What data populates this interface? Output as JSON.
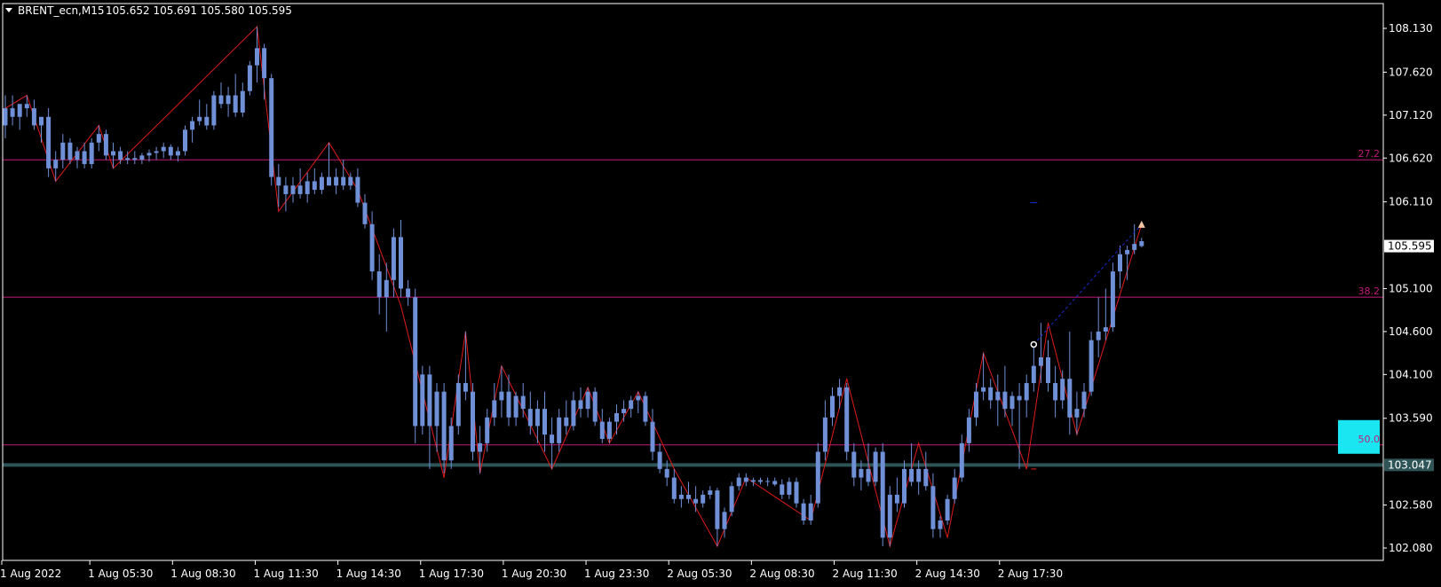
{
  "header": {
    "symbol": "BRENT_ecn,M15",
    "ohlc": "105.652 105.691 105.580 105.595"
  },
  "colors": {
    "background": "#000000",
    "frame": "#ffffff",
    "candle_body": "#6f8fd6",
    "candle_wick": "#6f8fd6",
    "zigzag": "#e01b1b",
    "fibo": "#c2197a",
    "support": "#2f5457",
    "cyan_box": "#19e6f0",
    "projection": "#1b2bd6",
    "arrow_marker": "#f3c6a0"
  },
  "chart_data": {
    "type": "candlestick",
    "symbol": "BRENT_ecn",
    "timeframe": "M15",
    "ylim": [
      101.95,
      108.35
    ],
    "y_ticks": [
      "108.130",
      "107.620",
      "107.120",
      "106.620",
      "106.110",
      "105.595",
      "105.100",
      "104.600",
      "104.100",
      "103.590",
      "103.047",
      "102.580",
      "102.080"
    ],
    "x_ticks": [
      "1 Aug 2022",
      "1 Aug 05:30",
      "1 Aug 08:30",
      "1 Aug 11:30",
      "1 Aug 14:30",
      "1 Aug 17:30",
      "1 Aug 20:30",
      "1 Aug 23:30",
      "2 Aug 05:30",
      "2 Aug 08:30",
      "2 Aug 11:30",
      "2 Aug 14:30",
      "2 Aug 17:30"
    ],
    "current_price": "105.595",
    "support_price": "103.047",
    "fibo_levels": [
      {
        "label": "27.2",
        "price": 106.6
      },
      {
        "label": "38.2",
        "price": 105.0
      },
      {
        "label": "50.0",
        "price": 103.28
      }
    ],
    "zigzag": [
      {
        "bar": 0,
        "price": 107.2
      },
      {
        "bar": 3,
        "price": 107.35
      },
      {
        "bar": 7,
        "price": 106.35
      },
      {
        "bar": 13,
        "price": 107.0
      },
      {
        "bar": 15,
        "price": 106.5
      },
      {
        "bar": 35,
        "price": 108.15
      },
      {
        "bar": 38,
        "price": 106.0
      },
      {
        "bar": 45,
        "price": 106.8
      },
      {
        "bar": 49,
        "price": 106.25
      },
      {
        "bar": 55,
        "price": 104.9
      },
      {
        "bar": 61,
        "price": 102.9
      },
      {
        "bar": 64,
        "price": 104.6
      },
      {
        "bar": 66,
        "price": 102.95
      },
      {
        "bar": 69,
        "price": 104.2
      },
      {
        "bar": 76,
        "price": 103.0
      },
      {
        "bar": 81,
        "price": 103.95
      },
      {
        "bar": 84,
        "price": 103.3
      },
      {
        "bar": 88,
        "price": 103.9
      },
      {
        "bar": 93,
        "price": 103.0
      },
      {
        "bar": 99,
        "price": 102.1
      },
      {
        "bar": 103,
        "price": 102.9
      },
      {
        "bar": 112,
        "price": 102.4
      },
      {
        "bar": 117,
        "price": 104.05
      },
      {
        "bar": 123,
        "price": 102.1
      },
      {
        "bar": 127,
        "price": 103.3
      },
      {
        "bar": 131,
        "price": 102.2
      },
      {
        "bar": 136,
        "price": 104.35
      },
      {
        "bar": 142,
        "price": 103.0
      },
      {
        "bar": 145,
        "price": 104.7
      },
      {
        "bar": 149,
        "price": 103.4
      },
      {
        "bar": 158,
        "price": 105.85
      }
    ],
    "projection": [
      {
        "bar": 143,
        "price": 104.45
      },
      {
        "bar": 158,
        "price": 105.85
      }
    ],
    "ohlc": [
      {
        "o": 107.0,
        "h": 107.35,
        "l": 106.85,
        "c": 107.2
      },
      {
        "o": 107.2,
        "h": 107.35,
        "l": 107.0,
        "c": 107.1
      },
      {
        "o": 107.1,
        "h": 107.2,
        "l": 106.95,
        "c": 107.25
      },
      {
        "o": 107.25,
        "h": 107.35,
        "l": 107.1,
        "c": 107.2
      },
      {
        "o": 107.2,
        "h": 107.3,
        "l": 106.95,
        "c": 107.0
      },
      {
        "o": 107.0,
        "h": 107.1,
        "l": 106.8,
        "c": 107.1
      },
      {
        "o": 107.1,
        "h": 107.2,
        "l": 106.4,
        "c": 106.5
      },
      {
        "o": 106.5,
        "h": 106.7,
        "l": 106.35,
        "c": 106.6
      },
      {
        "o": 106.6,
        "h": 106.9,
        "l": 106.5,
        "c": 106.8
      },
      {
        "o": 106.8,
        "h": 106.85,
        "l": 106.55,
        "c": 106.6
      },
      {
        "o": 106.6,
        "h": 106.75,
        "l": 106.5,
        "c": 106.7
      },
      {
        "o": 106.7,
        "h": 106.8,
        "l": 106.5,
        "c": 106.55
      },
      {
        "o": 106.55,
        "h": 106.85,
        "l": 106.5,
        "c": 106.8
      },
      {
        "o": 106.8,
        "h": 107.0,
        "l": 106.7,
        "c": 106.9
      },
      {
        "o": 106.9,
        "h": 106.95,
        "l": 106.6,
        "c": 106.65
      },
      {
        "o": 106.65,
        "h": 106.8,
        "l": 106.5,
        "c": 106.7
      },
      {
        "o": 106.7,
        "h": 106.75,
        "l": 106.55,
        "c": 106.6
      },
      {
        "o": 106.6,
        "h": 106.7,
        "l": 106.55,
        "c": 106.62
      },
      {
        "o": 106.62,
        "h": 106.7,
        "l": 106.55,
        "c": 106.6
      },
      {
        "o": 106.6,
        "h": 106.68,
        "l": 106.55,
        "c": 106.65
      },
      {
        "o": 106.65,
        "h": 106.72,
        "l": 106.58,
        "c": 106.68
      },
      {
        "o": 106.68,
        "h": 106.75,
        "l": 106.6,
        "c": 106.7
      },
      {
        "o": 106.7,
        "h": 106.8,
        "l": 106.62,
        "c": 106.75
      },
      {
        "o": 106.75,
        "h": 106.78,
        "l": 106.6,
        "c": 106.65
      },
      {
        "o": 106.65,
        "h": 106.75,
        "l": 106.58,
        "c": 106.7
      },
      {
        "o": 106.7,
        "h": 107.0,
        "l": 106.65,
        "c": 106.95
      },
      {
        "o": 106.95,
        "h": 107.1,
        "l": 106.8,
        "c": 107.05
      },
      {
        "o": 107.05,
        "h": 107.3,
        "l": 107.0,
        "c": 107.1
      },
      {
        "o": 107.1,
        "h": 107.25,
        "l": 106.95,
        "c": 107.0
      },
      {
        "o": 107.0,
        "h": 107.4,
        "l": 106.95,
        "c": 107.35
      },
      {
        "o": 107.35,
        "h": 107.5,
        "l": 107.2,
        "c": 107.25
      },
      {
        "o": 107.25,
        "h": 107.45,
        "l": 107.1,
        "c": 107.35
      },
      {
        "o": 107.35,
        "h": 107.6,
        "l": 107.1,
        "c": 107.15
      },
      {
        "o": 107.15,
        "h": 107.5,
        "l": 107.1,
        "c": 107.4
      },
      {
        "o": 107.4,
        "h": 107.75,
        "l": 107.35,
        "c": 107.7
      },
      {
        "o": 107.7,
        "h": 108.15,
        "l": 107.5,
        "c": 107.9
      },
      {
        "o": 107.9,
        "h": 107.95,
        "l": 107.3,
        "c": 107.55
      },
      {
        "o": 107.55,
        "h": 107.6,
        "l": 106.3,
        "c": 106.4
      },
      {
        "o": 106.4,
        "h": 106.55,
        "l": 106.05,
        "c": 106.3
      },
      {
        "o": 106.3,
        "h": 106.4,
        "l": 106.0,
        "c": 106.2
      },
      {
        "o": 106.2,
        "h": 106.4,
        "l": 106.1,
        "c": 106.3
      },
      {
        "o": 106.3,
        "h": 106.5,
        "l": 106.15,
        "c": 106.2
      },
      {
        "o": 106.2,
        "h": 106.45,
        "l": 106.1,
        "c": 106.35
      },
      {
        "o": 106.35,
        "h": 106.5,
        "l": 106.2,
        "c": 106.25
      },
      {
        "o": 106.25,
        "h": 106.45,
        "l": 106.2,
        "c": 106.4
      },
      {
        "o": 106.4,
        "h": 106.8,
        "l": 106.3,
        "c": 106.3
      },
      {
        "o": 106.3,
        "h": 106.5,
        "l": 106.2,
        "c": 106.4
      },
      {
        "o": 106.4,
        "h": 106.6,
        "l": 106.25,
        "c": 106.3
      },
      {
        "o": 106.3,
        "h": 106.45,
        "l": 106.25,
        "c": 106.4
      },
      {
        "o": 106.4,
        "h": 106.5,
        "l": 106.05,
        "c": 106.1
      },
      {
        "o": 106.1,
        "h": 106.2,
        "l": 105.8,
        "c": 105.85
      },
      {
        "o": 105.85,
        "h": 106.0,
        "l": 105.2,
        "c": 105.3
      },
      {
        "o": 105.3,
        "h": 105.5,
        "l": 104.8,
        "c": 105.0
      },
      {
        "o": 105.0,
        "h": 105.4,
        "l": 104.6,
        "c": 105.2
      },
      {
        "o": 105.2,
        "h": 105.8,
        "l": 105.0,
        "c": 105.7
      },
      {
        "o": 105.7,
        "h": 105.9,
        "l": 105.0,
        "c": 105.1
      },
      {
        "o": 105.1,
        "h": 105.2,
        "l": 104.9,
        "c": 105.0
      },
      {
        "o": 105.0,
        "h": 105.1,
        "l": 103.3,
        "c": 103.5
      },
      {
        "o": 103.5,
        "h": 104.2,
        "l": 103.4,
        "c": 104.1
      },
      {
        "o": 104.1,
        "h": 104.2,
        "l": 103.0,
        "c": 103.5
      },
      {
        "o": 103.5,
        "h": 104.0,
        "l": 103.2,
        "c": 103.9
      },
      {
        "o": 103.9,
        "h": 104.0,
        "l": 102.95,
        "c": 103.1
      },
      {
        "o": 103.1,
        "h": 103.6,
        "l": 103.0,
        "c": 103.5
      },
      {
        "o": 103.5,
        "h": 104.1,
        "l": 103.4,
        "c": 104.0
      },
      {
        "o": 104.0,
        "h": 104.6,
        "l": 103.8,
        "c": 103.9
      },
      {
        "o": 103.9,
        "h": 104.0,
        "l": 103.1,
        "c": 103.2
      },
      {
        "o": 103.2,
        "h": 103.5,
        "l": 102.95,
        "c": 103.3
      },
      {
        "o": 103.3,
        "h": 103.7,
        "l": 103.2,
        "c": 103.6
      },
      {
        "o": 103.6,
        "h": 104.0,
        "l": 103.5,
        "c": 103.8
      },
      {
        "o": 103.8,
        "h": 104.2,
        "l": 103.6,
        "c": 103.9
      },
      {
        "o": 103.9,
        "h": 104.1,
        "l": 103.5,
        "c": 103.6
      },
      {
        "o": 103.6,
        "h": 103.9,
        "l": 103.5,
        "c": 103.85
      },
      {
        "o": 103.85,
        "h": 104.0,
        "l": 103.6,
        "c": 103.7
      },
      {
        "o": 103.7,
        "h": 103.9,
        "l": 103.4,
        "c": 103.5
      },
      {
        "o": 103.5,
        "h": 103.8,
        "l": 103.3,
        "c": 103.7
      },
      {
        "o": 103.7,
        "h": 103.9,
        "l": 103.2,
        "c": 103.4
      },
      {
        "o": 103.4,
        "h": 103.6,
        "l": 103.0,
        "c": 103.3
      },
      {
        "o": 103.3,
        "h": 103.7,
        "l": 103.2,
        "c": 103.6
      },
      {
        "o": 103.6,
        "h": 103.8,
        "l": 103.4,
        "c": 103.5
      },
      {
        "o": 103.5,
        "h": 103.9,
        "l": 103.45,
        "c": 103.8
      },
      {
        "o": 103.8,
        "h": 103.95,
        "l": 103.6,
        "c": 103.7
      },
      {
        "o": 103.7,
        "h": 103.95,
        "l": 103.6,
        "c": 103.9
      },
      {
        "o": 103.9,
        "h": 103.95,
        "l": 103.5,
        "c": 103.55
      },
      {
        "o": 103.55,
        "h": 103.7,
        "l": 103.3,
        "c": 103.35
      },
      {
        "o": 103.35,
        "h": 103.6,
        "l": 103.3,
        "c": 103.55
      },
      {
        "o": 103.55,
        "h": 103.75,
        "l": 103.4,
        "c": 103.65
      },
      {
        "o": 103.65,
        "h": 103.8,
        "l": 103.55,
        "c": 103.7
      },
      {
        "o": 103.7,
        "h": 103.85,
        "l": 103.6,
        "c": 103.8
      },
      {
        "o": 103.8,
        "h": 103.9,
        "l": 103.65,
        "c": 103.85
      },
      {
        "o": 103.85,
        "h": 103.9,
        "l": 103.5,
        "c": 103.55
      },
      {
        "o": 103.55,
        "h": 103.7,
        "l": 103.1,
        "c": 103.2
      },
      {
        "o": 103.2,
        "h": 103.3,
        "l": 102.95,
        "c": 103.0
      },
      {
        "o": 103.0,
        "h": 103.1,
        "l": 102.8,
        "c": 102.9
      },
      {
        "o": 102.9,
        "h": 103.0,
        "l": 102.6,
        "c": 102.65
      },
      {
        "o": 102.65,
        "h": 102.8,
        "l": 102.55,
        "c": 102.7
      },
      {
        "o": 102.7,
        "h": 102.85,
        "l": 102.6,
        "c": 102.65
      },
      {
        "o": 102.65,
        "h": 102.8,
        "l": 102.5,
        "c": 102.6
      },
      {
        "o": 102.6,
        "h": 102.75,
        "l": 102.55,
        "c": 102.7
      },
      {
        "o": 102.7,
        "h": 102.8,
        "l": 102.65,
        "c": 102.75
      },
      {
        "o": 102.75,
        "h": 102.78,
        "l": 102.1,
        "c": 102.3
      },
      {
        "o": 102.3,
        "h": 102.55,
        "l": 102.2,
        "c": 102.5
      },
      {
        "o": 102.5,
        "h": 102.85,
        "l": 102.45,
        "c": 102.8
      },
      {
        "o": 102.8,
        "h": 102.95,
        "l": 102.75,
        "c": 102.9
      },
      {
        "o": 102.9,
        "h": 102.95,
        "l": 102.8,
        "c": 102.85
      },
      {
        "o": 102.85,
        "h": 102.9,
        "l": 102.8,
        "c": 102.87
      },
      {
        "o": 102.87,
        "h": 102.9,
        "l": 102.82,
        "c": 102.85
      },
      {
        "o": 102.85,
        "h": 102.9,
        "l": 102.8,
        "c": 102.86
      },
      {
        "o": 102.86,
        "h": 102.9,
        "l": 102.8,
        "c": 102.82
      },
      {
        "o": 102.82,
        "h": 102.88,
        "l": 102.65,
        "c": 102.7
      },
      {
        "o": 102.7,
        "h": 102.9,
        "l": 102.65,
        "c": 102.85
      },
      {
        "o": 102.85,
        "h": 102.9,
        "l": 102.55,
        "c": 102.6
      },
      {
        "o": 102.6,
        "h": 102.65,
        "l": 102.35,
        "c": 102.4
      },
      {
        "o": 102.4,
        "h": 102.7,
        "l": 102.35,
        "c": 102.6
      },
      {
        "o": 102.6,
        "h": 103.3,
        "l": 102.55,
        "c": 103.2
      },
      {
        "o": 103.2,
        "h": 103.8,
        "l": 103.1,
        "c": 103.6
      },
      {
        "o": 103.6,
        "h": 103.95,
        "l": 103.5,
        "c": 103.85
      },
      {
        "o": 103.85,
        "h": 104.05,
        "l": 103.7,
        "c": 103.95
      },
      {
        "o": 103.95,
        "h": 104.0,
        "l": 103.1,
        "c": 103.2
      },
      {
        "o": 103.2,
        "h": 103.3,
        "l": 102.8,
        "c": 102.9
      },
      {
        "o": 102.9,
        "h": 103.1,
        "l": 102.75,
        "c": 103.0
      },
      {
        "o": 103.0,
        "h": 103.3,
        "l": 102.8,
        "c": 102.85
      },
      {
        "o": 102.85,
        "h": 103.25,
        "l": 102.8,
        "c": 103.2
      },
      {
        "o": 103.2,
        "h": 103.3,
        "l": 102.1,
        "c": 102.2
      },
      {
        "o": 102.2,
        "h": 102.8,
        "l": 102.1,
        "c": 102.7
      },
      {
        "o": 102.7,
        "h": 102.9,
        "l": 102.5,
        "c": 102.6
      },
      {
        "o": 102.6,
        "h": 103.1,
        "l": 102.55,
        "c": 103.0
      },
      {
        "o": 103.0,
        "h": 103.3,
        "l": 102.8,
        "c": 102.85
      },
      {
        "o": 102.85,
        "h": 103.1,
        "l": 102.7,
        "c": 103.0
      },
      {
        "o": 103.0,
        "h": 103.2,
        "l": 102.75,
        "c": 102.8
      },
      {
        "o": 102.8,
        "h": 102.95,
        "l": 102.2,
        "c": 102.3
      },
      {
        "o": 102.3,
        "h": 102.45,
        "l": 102.2,
        "c": 102.4
      },
      {
        "o": 102.4,
        "h": 102.7,
        "l": 102.35,
        "c": 102.65
      },
      {
        "o": 102.65,
        "h": 103.0,
        "l": 102.6,
        "c": 102.9
      },
      {
        "o": 102.9,
        "h": 103.4,
        "l": 102.85,
        "c": 103.3
      },
      {
        "o": 103.3,
        "h": 103.7,
        "l": 103.2,
        "c": 103.6
      },
      {
        "o": 103.6,
        "h": 104.0,
        "l": 103.5,
        "c": 103.9
      },
      {
        "o": 103.9,
        "h": 104.35,
        "l": 103.8,
        "c": 103.95
      },
      {
        "o": 103.95,
        "h": 104.05,
        "l": 103.7,
        "c": 103.8
      },
      {
        "o": 103.8,
        "h": 104.1,
        "l": 103.5,
        "c": 103.9
      },
      {
        "o": 103.9,
        "h": 104.2,
        "l": 103.6,
        "c": 103.7
      },
      {
        "o": 103.7,
        "h": 103.9,
        "l": 103.5,
        "c": 103.85
      },
      {
        "o": 103.85,
        "h": 104.0,
        "l": 103.0,
        "c": 103.8
      },
      {
        "o": 103.8,
        "h": 104.1,
        "l": 103.6,
        "c": 104.0
      },
      {
        "o": 104.0,
        "h": 104.45,
        "l": 103.9,
        "c": 104.2
      },
      {
        "o": 104.2,
        "h": 104.7,
        "l": 104.0,
        "c": 104.3
      },
      {
        "o": 104.3,
        "h": 104.5,
        "l": 103.9,
        "c": 104.0
      },
      {
        "o": 104.0,
        "h": 104.2,
        "l": 103.6,
        "c": 103.8
      },
      {
        "o": 103.8,
        "h": 104.15,
        "l": 103.7,
        "c": 104.05
      },
      {
        "o": 104.05,
        "h": 104.6,
        "l": 103.4,
        "c": 103.6
      },
      {
        "o": 103.6,
        "h": 103.9,
        "l": 103.4,
        "c": 103.7
      },
      {
        "o": 103.7,
        "h": 104.0,
        "l": 103.6,
        "c": 103.9
      },
      {
        "o": 103.9,
        "h": 104.6,
        "l": 103.85,
        "c": 104.5
      },
      {
        "o": 104.5,
        "h": 105.0,
        "l": 104.3,
        "c": 104.6
      },
      {
        "o": 104.6,
        "h": 105.1,
        "l": 104.5,
        "c": 104.65
      },
      {
        "o": 104.65,
        "h": 105.4,
        "l": 104.6,
        "c": 105.3
      },
      {
        "o": 105.3,
        "h": 105.6,
        "l": 105.1,
        "c": 105.5
      },
      {
        "o": 105.5,
        "h": 105.6,
        "l": 105.2,
        "c": 105.55
      },
      {
        "o": 105.55,
        "h": 105.85,
        "l": 105.5,
        "c": 105.62
      },
      {
        "o": 105.652,
        "h": 105.691,
        "l": 105.58,
        "c": 105.595
      }
    ]
  }
}
